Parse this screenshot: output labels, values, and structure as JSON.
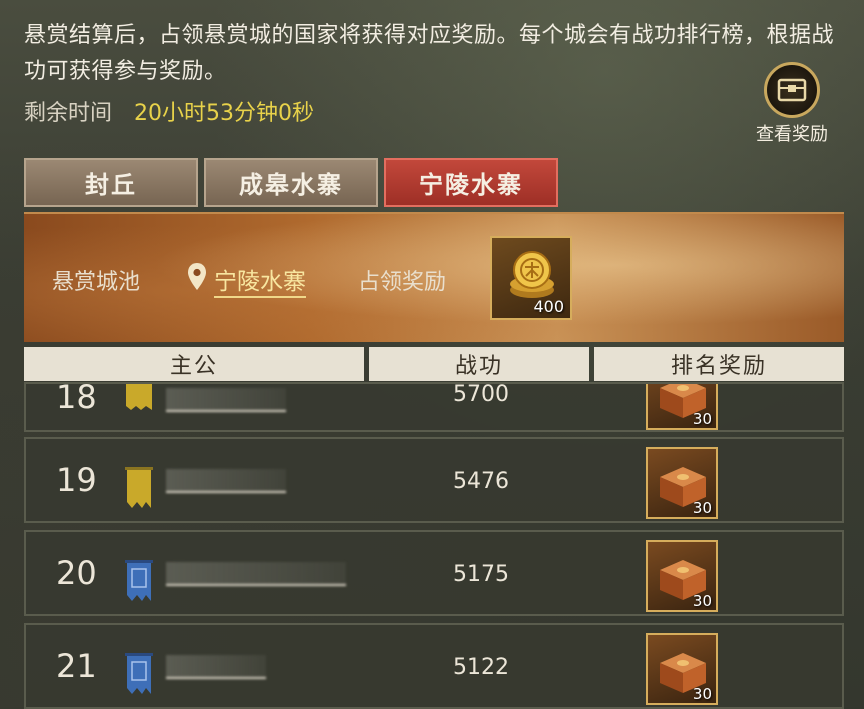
{
  "info": {
    "description": "悬赏结算后，占领悬赏城的国家将获得对应奖励。每个城会有战功排行榜，根据战功可获得参与奖励。",
    "remaining_label": "剩余时间",
    "remaining_value": "20小时53分钟0秒",
    "view_rewards_label": "查看奖励"
  },
  "tabs": [
    {
      "label": "封丘",
      "active": false
    },
    {
      "label": "成皋水寨",
      "active": false
    },
    {
      "label": "宁陵水寨",
      "active": true
    }
  ],
  "banner": {
    "city_label": "悬赏城池",
    "city_name": "宁陵水寨",
    "occupy_reward_label": "占领奖励",
    "reward_qty": "400"
  },
  "table": {
    "headers": [
      "主公",
      "战功",
      "排名奖励"
    ],
    "rows": [
      {
        "rank": "18",
        "score": "5700",
        "flag_color": "#c9a92a",
        "reward_qty": "30"
      },
      {
        "rank": "19",
        "score": "5476",
        "flag_color": "#c9a92a",
        "reward_qty": "30"
      },
      {
        "rank": "20",
        "score": "5175",
        "flag_color": "#3e6fb8",
        "reward_qty": "30"
      },
      {
        "rank": "21",
        "score": "5122",
        "flag_color": "#3e6fb8",
        "reward_qty": "30"
      }
    ]
  },
  "colors": {
    "accent_gold": "#e8d24a",
    "active_tab": "#c2483b"
  }
}
